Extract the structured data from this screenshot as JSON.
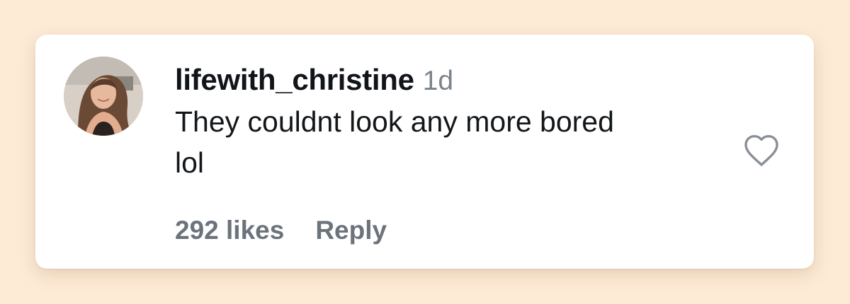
{
  "comment": {
    "username": "lifewith_christine",
    "timestamp": "1d",
    "text": "They couldnt look any more bored lol",
    "likes_label": "292 likes",
    "reply_label": "Reply",
    "like_icon": "heart-outline-icon",
    "avatar": "profile-photo"
  },
  "colors": {
    "page_background": "#fdebd6",
    "card_background": "#ffffff",
    "username": "#111418",
    "secondary_text": "#7c838c",
    "heart_stroke": "#8a8f96"
  }
}
